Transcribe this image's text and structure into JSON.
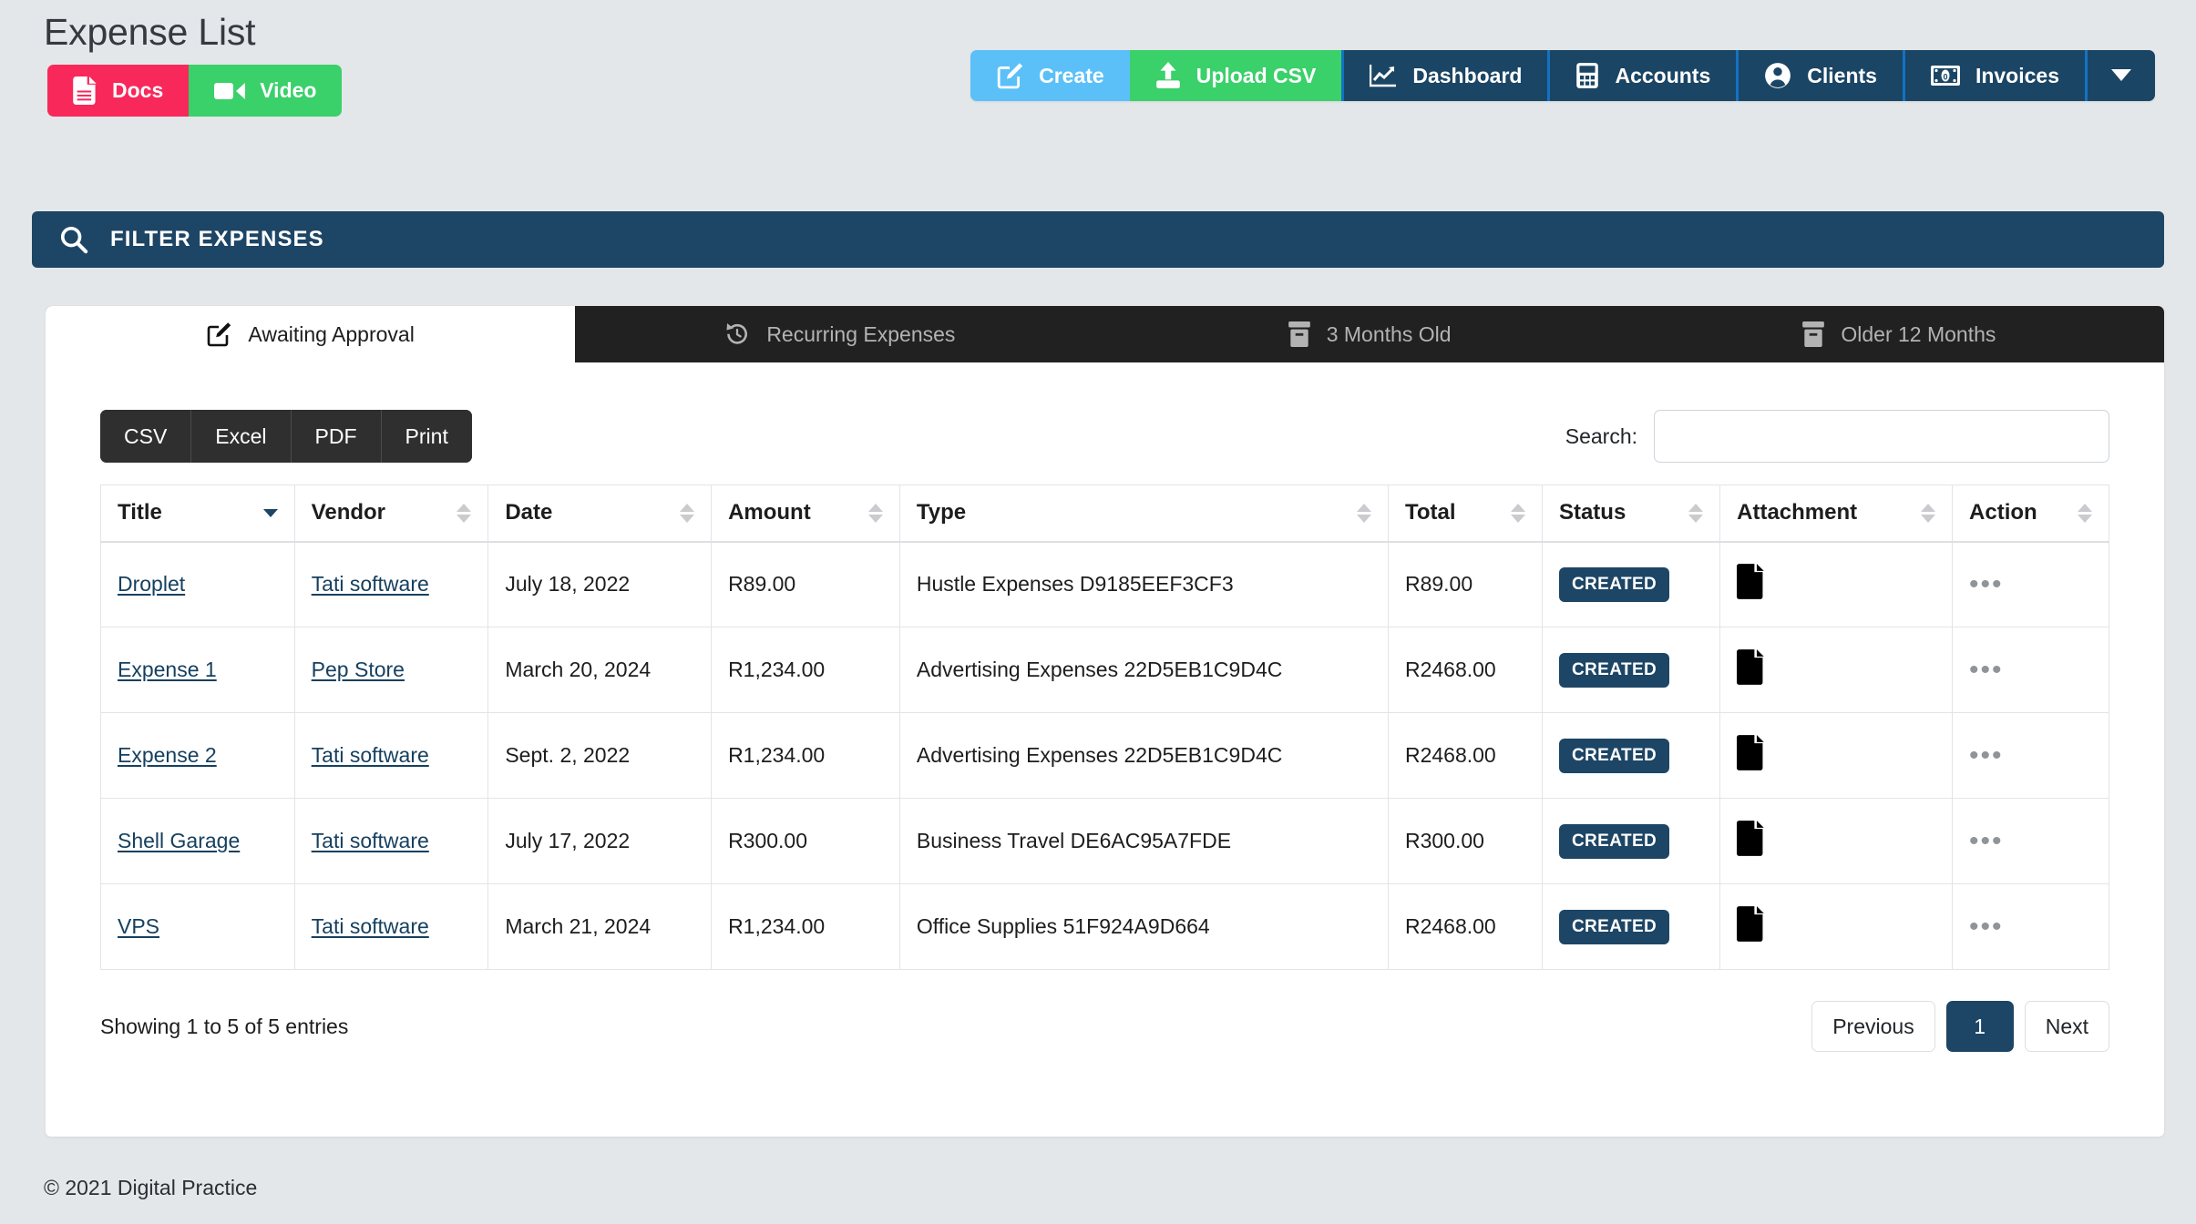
{
  "header": {
    "title": "Expense List",
    "docs_label": "Docs",
    "video_label": "Video",
    "docs_icon": "file-doc-icon",
    "video_icon": "video-camera-icon",
    "docs_color": "#f8285a",
    "video_color": "#3ad06a"
  },
  "top_nav": {
    "items": [
      {
        "label": "Create",
        "icon": "edit-square-icon",
        "color": "#5bc0f8"
      },
      {
        "label": "Upload CSV",
        "icon": "upload-icon",
        "color": "#3ad06a"
      },
      {
        "label": "Dashboard",
        "icon": "chart-line-icon",
        "color": "#1b4564"
      },
      {
        "label": "Accounts",
        "icon": "calculator-icon",
        "color": "#1b4564"
      },
      {
        "label": "Clients",
        "icon": "user-circle-icon",
        "color": "#1b4564"
      },
      {
        "label": "Invoices",
        "icon": "money-bill-icon",
        "color": "#1b4564"
      }
    ],
    "caret_icon": "caret-down-icon"
  },
  "filter_bar": {
    "label": "FILTER EXPENSES",
    "icon": "search-icon",
    "color": "#1d4565"
  },
  "tabs": [
    {
      "label": "Awaiting Approval",
      "icon": "edit-square-icon",
      "active": true
    },
    {
      "label": "Recurring Expenses",
      "icon": "history-icon",
      "active": false
    },
    {
      "label": "3 Months Old",
      "icon": "archive-icon",
      "active": false
    },
    {
      "label": "Older 12 Months",
      "icon": "archive-icon",
      "active": false
    }
  ],
  "table_tools": {
    "export_buttons": [
      "CSV",
      "Excel",
      "PDF",
      "Print"
    ],
    "search_label": "Search:",
    "search_value": "",
    "search_placeholder": ""
  },
  "table": {
    "columns": [
      {
        "label": "Title",
        "sort": "asc"
      },
      {
        "label": "Vendor",
        "sort": "none"
      },
      {
        "label": "Date",
        "sort": "none"
      },
      {
        "label": "Amount",
        "sort": "none"
      },
      {
        "label": "Type",
        "sort": "none"
      },
      {
        "label": "Total",
        "sort": "none"
      },
      {
        "label": "Status",
        "sort": "none"
      },
      {
        "label": "Attachment",
        "sort": "none"
      },
      {
        "label": "Action",
        "sort": "none"
      }
    ],
    "rows": [
      {
        "title": "Droplet",
        "vendor": "Tati software",
        "date": "July 18, 2022",
        "amount": "R89.00",
        "type": "Hustle Expenses D9185EEF3CF3",
        "total": "R89.00",
        "status": "CREATED",
        "attachment_icon": "file-icon",
        "action_icon": "ellipsis-icon"
      },
      {
        "title": "Expense 1",
        "vendor": "Pep Store",
        "date": "March 20, 2024",
        "amount": "R1,234.00",
        "type": "Advertising Expenses 22D5EB1C9D4C",
        "total": "R2468.00",
        "status": "CREATED",
        "attachment_icon": "file-icon",
        "action_icon": "ellipsis-icon"
      },
      {
        "title": "Expense 2",
        "vendor": "Tati software",
        "date": "Sept. 2, 2022",
        "amount": "R1,234.00",
        "type": "Advertising Expenses 22D5EB1C9D4C",
        "total": "R2468.00",
        "status": "CREATED",
        "attachment_icon": "file-icon",
        "action_icon": "ellipsis-icon"
      },
      {
        "title": "Shell Garage",
        "vendor": "Tati software",
        "date": "July 17, 2022",
        "amount": "R300.00",
        "type": "Business Travel DE6AC95A7FDE",
        "total": "R300.00",
        "status": "CREATED",
        "attachment_icon": "file-icon",
        "action_icon": "ellipsis-icon"
      },
      {
        "title": "VPS",
        "vendor": "Tati software",
        "date": "March 21, 2024",
        "amount": "R1,234.00",
        "type": "Office Supplies 51F924A9D664",
        "total": "R2468.00",
        "status": "CREATED",
        "attachment_icon": "file-icon",
        "action_icon": "ellipsis-icon"
      }
    ]
  },
  "table_footer": {
    "entries_info": "Showing 1 to 5 of 5 entries",
    "previous_label": "Previous",
    "next_label": "Next",
    "current_page": "1"
  },
  "page_footer": {
    "copyright": "© 2021 Digital Practice"
  },
  "colors": {
    "accent_dark": "#1d4565",
    "accent_blue": "#5bc0f8",
    "accent_green": "#3ad06a",
    "accent_red": "#f8285a",
    "page_bg": "#e4e7e9",
    "tabs_bg": "#212121"
  }
}
